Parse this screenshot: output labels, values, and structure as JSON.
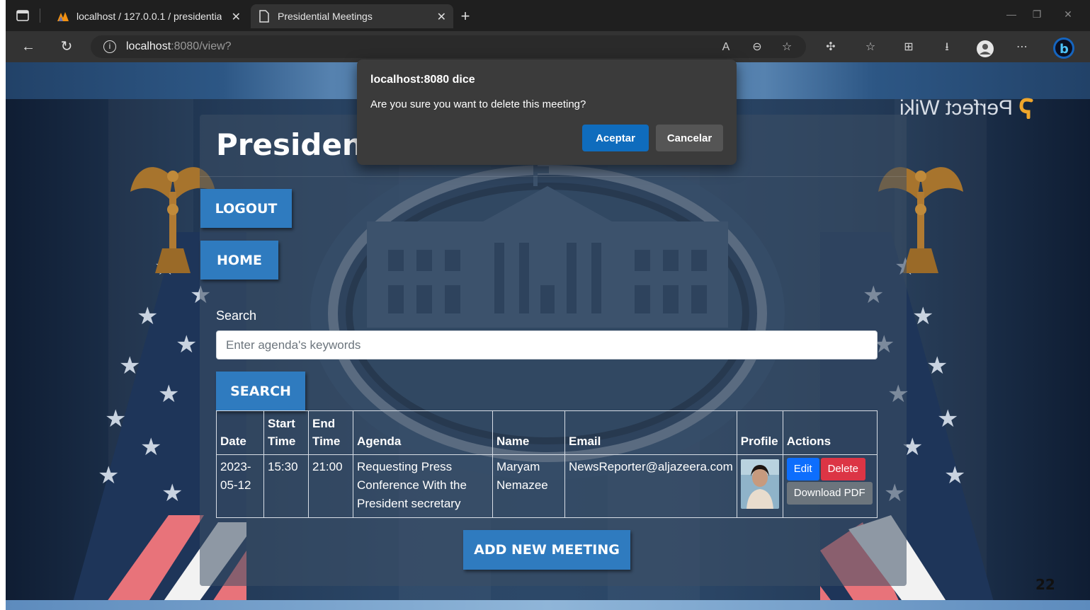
{
  "browser": {
    "tabs": [
      {
        "title": "localhost / 127.0.0.1 / presidentia",
        "icon": "phpmyadmin-icon"
      },
      {
        "title": "Presidential Meetings",
        "icon": "page-icon"
      }
    ],
    "url_host": "localhost",
    "url_path": ":8080/view?"
  },
  "page": {
    "title": "Presidential Meetings",
    "logout_label": "LOGOUT",
    "home_label": "HOME",
    "search_label": "Search",
    "search_placeholder": "Enter agenda's keywords",
    "search_button_label": "SEARCH",
    "add_meeting_label": "ADD NEW MEETING",
    "brand": "Perfect Wiki",
    "page_number": "22"
  },
  "table": {
    "headers": {
      "date": "Date",
      "start_time": "Start Time",
      "end_time": "End Time",
      "agenda": "Agenda",
      "name": "Name",
      "email": "Email",
      "profile": "Profile",
      "actions": "Actions"
    },
    "rows": [
      {
        "date": "2023-05-12",
        "start_time": "15:30",
        "end_time": "21:00",
        "agenda": "Requesting Press Conference With the President secretary",
        "name": "Maryam Nemazee",
        "email": "NewsReporter@aljazeera.com",
        "edit_label": "Edit",
        "delete_label": "Delete",
        "pdf_label": "Download PDF"
      }
    ]
  },
  "dialog": {
    "title": "localhost:8080 dice",
    "message": "Are you sure you want to delete this meeting?",
    "ok_label": "Aceptar",
    "cancel_label": "Cancelar"
  },
  "colors": {
    "primary_button": "#2f7bbf",
    "dialog_ok": "#0f6cbd",
    "delete": "#dc3545",
    "edit": "#0d6efd"
  }
}
